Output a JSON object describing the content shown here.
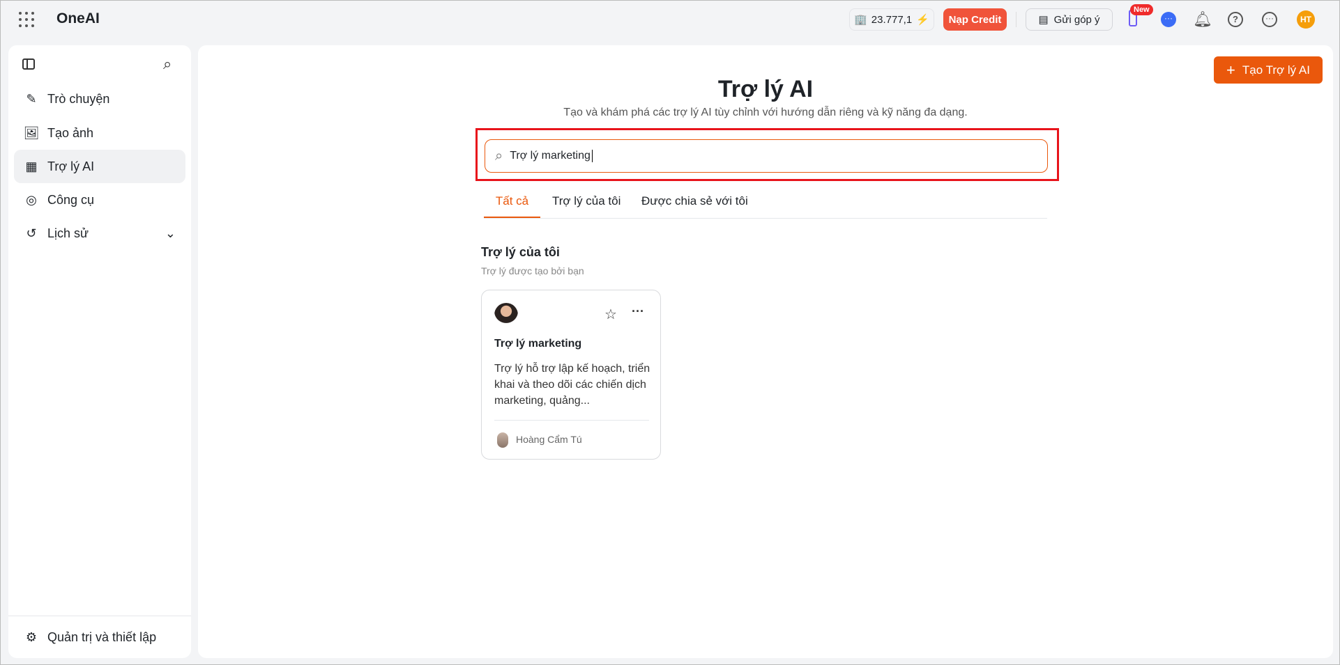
{
  "header": {
    "app_name": "OneAI",
    "credit": "23.777,1",
    "topup_label": "Nạp Credit",
    "feedback_label": "Gửi góp ý",
    "new_badge": "New",
    "avatar_initials": "HT",
    "accent": "#ea580c"
  },
  "sidebar": {
    "items": [
      {
        "label": "Trò chuyện",
        "icon": "edit-icon"
      },
      {
        "label": "Tạo ảnh",
        "icon": "image-plus-icon"
      },
      {
        "label": "Trợ lý AI",
        "icon": "grid-icon",
        "active": true
      },
      {
        "label": "Công cụ",
        "icon": "compass-icon"
      },
      {
        "label": "Lịch sử",
        "icon": "history-icon"
      }
    ],
    "settings_label": "Quản trị và thiết lập"
  },
  "main": {
    "create_label": "Tạo Trợ lý AI",
    "title": "Trợ lý AI",
    "subtitle": "Tạo và khám phá các trợ lý AI tùy chỉnh với hướng dẫn riêng và kỹ năng đa dạng.",
    "search": {
      "value": "Trợ lý marketing"
    },
    "tabs": [
      {
        "label": "Tất cả",
        "active": true
      },
      {
        "label": "Trợ lý của tôi"
      },
      {
        "label": "Được chia sẻ với tôi"
      }
    ],
    "section": {
      "title": "Trợ lý của tôi",
      "subtitle": "Trợ lý được tạo bởi bạn"
    },
    "card": {
      "name": "Trợ lý marketing",
      "description": "Trợ lý hỗ trợ lập kế hoạch, triển khai và theo dõi các chiến dịch marketing, quảng...",
      "author": "Hoàng Cẩm Tú"
    }
  }
}
